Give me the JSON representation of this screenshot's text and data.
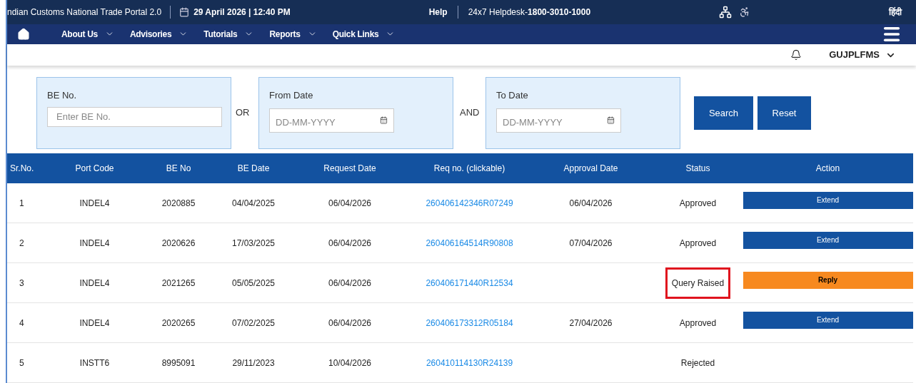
{
  "top_bar": {
    "portal_name": "ndian Customs National Trade Portal 2.0",
    "datetime": "29 April 2026 | 12:40 PM",
    "help": "Help",
    "helpdesk_label": "24x7 Helpdesk-",
    "helpdesk_number": "1800-3010-1000",
    "language": "हिंदी"
  },
  "nav": {
    "items": [
      {
        "label": "About Us"
      },
      {
        "label": "Advisories"
      },
      {
        "label": "Tutorials"
      },
      {
        "label": "Reports"
      },
      {
        "label": "Quick Links"
      }
    ]
  },
  "user_bar": {
    "username": "GUJPLFMS"
  },
  "filters": {
    "be_no": {
      "label": "BE No.",
      "placeholder": "Enter BE No."
    },
    "or_label": "OR",
    "from_date": {
      "label": "From Date",
      "placeholder": "DD-MM-YYYY"
    },
    "and_label": "AND",
    "to_date": {
      "label": "To Date",
      "placeholder": "DD-MM-YYYY"
    },
    "buttons": [
      "Search",
      "Reset"
    ]
  },
  "table": {
    "columns": [
      "Sr.No.",
      "Port Code",
      "BE No",
      "BE Date",
      "Request Date",
      "Req no. (clickable)",
      "Approval Date",
      "Status",
      "Action"
    ],
    "rows": [
      {
        "sr": "1",
        "port": "INDEL4",
        "be_no": "2020885",
        "be_date": "04/04/2025",
        "request_date": "06/04/2026",
        "req_no": "260406142346R07249",
        "approval_date": "06/04/2026",
        "status": "Approved",
        "highlighted": false,
        "action": {
          "kind": "extend",
          "label": "Extend"
        }
      },
      {
        "sr": "2",
        "port": "INDEL4",
        "be_no": "2020626",
        "be_date": "17/03/2025",
        "request_date": "06/04/2026",
        "req_no": "260406164514R90808",
        "approval_date": "07/04/2026",
        "status": "Approved",
        "highlighted": false,
        "action": {
          "kind": "extend",
          "label": "Extend"
        }
      },
      {
        "sr": "3",
        "port": "INDEL4",
        "be_no": "2021265",
        "be_date": "05/05/2025",
        "request_date": "06/04/2026",
        "req_no": "260406171440R12534",
        "status": "Query Raised",
        "highlighted": true,
        "action": {
          "kind": "reply",
          "label": "Reply"
        }
      },
      {
        "sr": "4",
        "port": "INDEL4",
        "be_no": "2020265",
        "be_date": "07/02/2025",
        "request_date": "06/04/2026",
        "req_no": "260406173312R05184",
        "approval_date": "27/04/2026",
        "status": "Approved",
        "highlighted": false,
        "action": {
          "kind": "extend",
          "label": "Extend"
        }
      },
      {
        "sr": "5",
        "port": "INSTT6",
        "be_no": "8995091",
        "be_date": "29/11/2023",
        "request_date": "10/04/2026",
        "req_no": "260410114130R24139",
        "status": "Rejected",
        "highlighted": false
      }
    ]
  }
}
